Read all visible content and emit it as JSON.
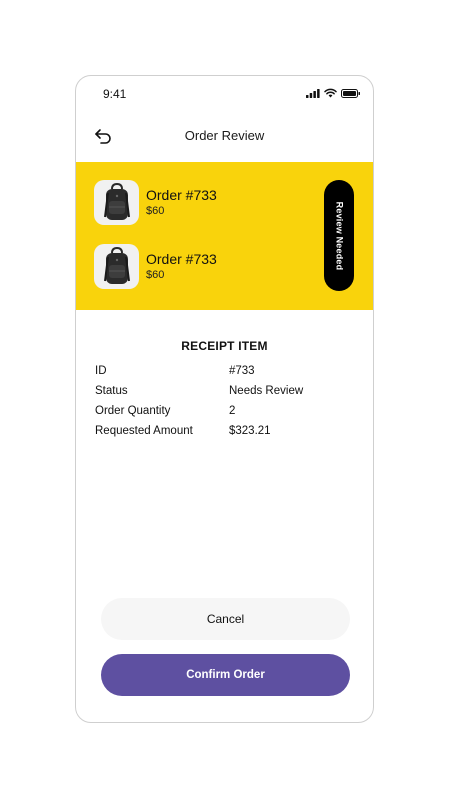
{
  "status_bar": {
    "time": "9:41"
  },
  "header": {
    "title": "Order Review",
    "back_icon": "undo-arrow-icon"
  },
  "colors": {
    "banner": "#f9d30c",
    "pill": "#000000",
    "confirm": "#5e50a1",
    "cancel": "#f6f6f6"
  },
  "orders": [
    {
      "name": "Order #733",
      "price": "$60",
      "icon": "backpack-icon"
    },
    {
      "name": "Order #733",
      "price": "$60",
      "icon": "backpack-icon"
    }
  ],
  "review_badge": {
    "label": "Review Needed"
  },
  "receipt": {
    "title": "RECEIPT ITEM",
    "rows": [
      {
        "key": "ID",
        "value": "#733"
      },
      {
        "key": "Status",
        "value": "Needs Review"
      },
      {
        "key": "Order Quantity",
        "value": "2"
      },
      {
        "key": "Requested Amount",
        "value": "$323.21"
      }
    ]
  },
  "actions": {
    "cancel_label": "Cancel",
    "confirm_label": "Confirm Order"
  }
}
